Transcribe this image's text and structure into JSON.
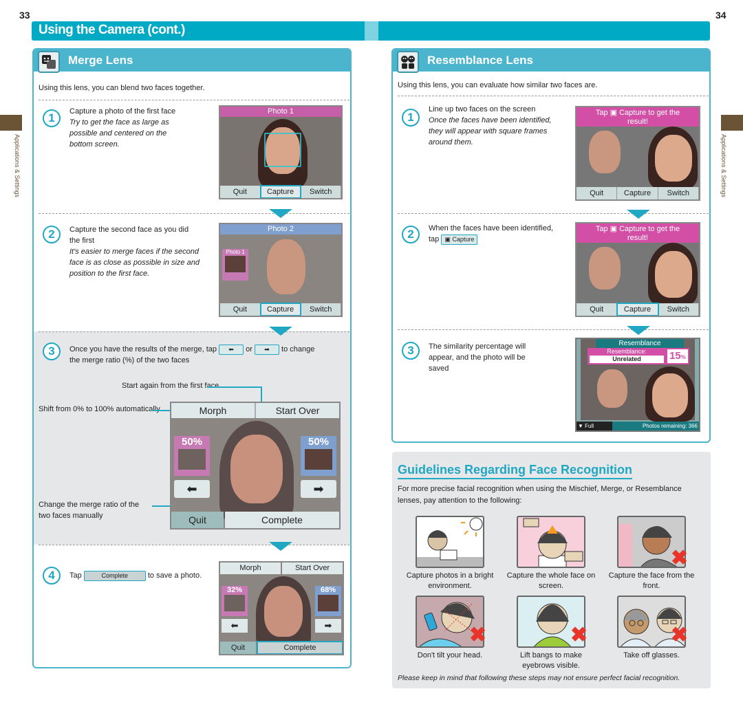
{
  "pages": {
    "left_number": "33",
    "right_number": "34"
  },
  "section_banner": {
    "title": "Using the Camera (cont.)"
  },
  "side_label": "Applications & Settings",
  "colors": {
    "accent": "#00a9c4",
    "panel": "#4ab5cc",
    "side_tab": "#6b5335",
    "x_mark": "#e8352b"
  },
  "merge_lens": {
    "title": "Merge Lens",
    "icon": "merge-faces-icon",
    "intro": "Using this lens, you can blend two faces together.",
    "steps": [
      {
        "num": "1",
        "text": "Capture a photo of the first face",
        "note": "Try to get the face as large as possible and centered on the bottom screen.",
        "screen": {
          "top_label": "Photo 1",
          "buttons": [
            "Quit",
            "Capture",
            "Switch"
          ],
          "highlight": "Capture"
        }
      },
      {
        "num": "2",
        "text": "Capture the second face as you did the first",
        "note": "It's easier to merge faces if the second face is as close as possible in size and position to the first face.",
        "screen": {
          "top_label": "Photo 2",
          "thumb_label": "Photo 1",
          "buttons": [
            "Quit",
            "Capture",
            "Switch"
          ],
          "highlight": "Capture"
        }
      },
      {
        "num": "3",
        "text_before": "Once you have the results of the merge, tap",
        "or": "or",
        "text_after": "to change the merge ratio (%) of the two faces",
        "left_arrow_icon": "left-arrow-icon",
        "right_arrow_icon": "right-arrow-icon",
        "callouts": {
          "start_over": "Start again from the first face",
          "morph": "Shift from 0% to 100% automatically",
          "manual": "Change the merge ratio of the two faces manually"
        },
        "screen": {
          "top_buttons": [
            "Morph",
            "Start Over"
          ],
          "left_pct": "50%",
          "right_pct": "50%",
          "bottom_buttons": [
            "Quit",
            "Complete"
          ]
        }
      },
      {
        "num": "4",
        "text_before": "Tap",
        "button": "Complete",
        "text_after": "to save a photo.",
        "screen": {
          "top_buttons": [
            "Morph",
            "Start Over"
          ],
          "left_pct": "32%",
          "right_pct": "68%",
          "bottom_buttons": [
            "Quit",
            "Complete"
          ],
          "highlight": "Complete"
        }
      }
    ]
  },
  "resemblance_lens": {
    "title": "Resemblance Lens",
    "icon": "two-faces-icon",
    "intro": "Using this lens, you can evaluate how similar two faces are.",
    "steps": [
      {
        "num": "1",
        "text": "Line up two faces on the screen",
        "note": "Once the faces have been identified, they will appear with square frames around them.",
        "screen": {
          "top_label": "Tap ▣ Capture to get the result!",
          "buttons": [
            "Quit",
            "Capture",
            "Switch"
          ]
        }
      },
      {
        "num": "2",
        "text": "When the faces have been identified,",
        "tap": "tap",
        "button": "Capture",
        "screen": {
          "top_label": "Tap ▣ Capture to get the result!",
          "buttons": [
            "Quit",
            "Capture",
            "Switch"
          ],
          "highlight": "Capture"
        }
      },
      {
        "num": "3",
        "text": "The similarity percentage will appear, and the photo will be saved",
        "screen": {
          "title": "Resemblance",
          "label": "Resemblance:",
          "result": "Unrelated",
          "percent": "15",
          "percent_unit": "%",
          "full_screen": "Full Screen",
          "photos_remaining": "Photos remaining: 366"
        }
      }
    ]
  },
  "guidelines": {
    "title": "Guidelines Regarding Face Recognition",
    "intro": "For more precise facial recognition when using the Mischief, Merge, or Resemblance lenses, pay attention to the following:",
    "items": [
      {
        "caption": "Capture photos in a bright environment.",
        "icon": "bright-light-icon",
        "ok": true
      },
      {
        "caption": "Capture the whole face on screen.",
        "icon": "whole-face-icon",
        "ok": true
      },
      {
        "caption": "Capture the face from the front.",
        "icon": "side-face-icon",
        "ok": false
      },
      {
        "caption": "Don't tilt your head.",
        "icon": "tilted-head-icon",
        "ok": false
      },
      {
        "caption": "Lift bangs to make eyebrows visible.",
        "icon": "bangs-icon",
        "ok": false
      },
      {
        "caption": "Take off glasses.",
        "icon": "glasses-icon",
        "ok": false
      }
    ],
    "note": "Please keep in mind that following these steps may not ensure perfect facial recognition."
  }
}
